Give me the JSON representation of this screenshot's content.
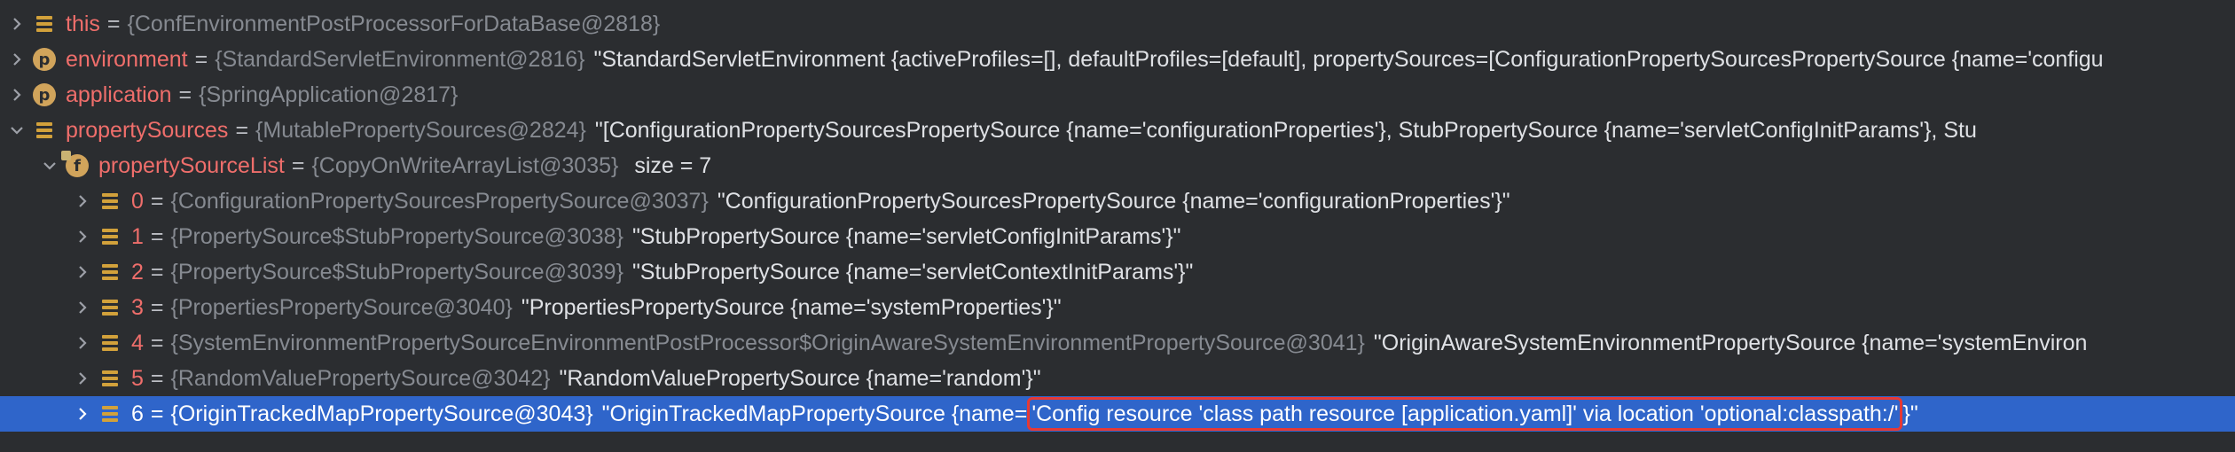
{
  "colors": {
    "background": "#2b2d30",
    "selected_row": "#2f65ca",
    "variable_name": "#ef6e6b",
    "reference": "#868a91",
    "value": "#dfe1e5",
    "icon": "#d2a13b",
    "highlight_border": "#e53935"
  },
  "rows": [
    {
      "icon": "field-lines-icon",
      "expanded": false,
      "name": "this",
      "ref": "{ConfEnvironmentPostProcessorForDataBase@2818}",
      "value": ""
    },
    {
      "icon": "property-p-icon",
      "badge": "p",
      "expanded": false,
      "name": "environment",
      "ref": "{StandardServletEnvironment@2816}",
      "value": "\"StandardServletEnvironment {activeProfiles=[], defaultProfiles=[default], propertySources=[ConfigurationPropertySourcesPropertySource {name='configu"
    },
    {
      "icon": "property-p-icon",
      "badge": "p",
      "expanded": false,
      "name": "application",
      "ref": "{SpringApplication@2817}",
      "value": ""
    },
    {
      "icon": "field-lines-icon",
      "expanded": true,
      "name": "propertySources",
      "ref": "{MutablePropertySources@2824}",
      "value": "\"[ConfigurationPropertySourcesPropertySource {name='configurationProperties'}, StubPropertySource {name='servletConfigInitParams'}, Stu"
    },
    {
      "icon": "final-field-f-icon",
      "badge": "f",
      "expanded": true,
      "name": "propertySourceList",
      "ref": "{CopyOnWriteArrayList@3035}",
      "value": "",
      "size": "size = 7"
    },
    {
      "icon": "field-lines-icon",
      "expanded": false,
      "name": "0",
      "ref": "{ConfigurationPropertySourcesPropertySource@3037}",
      "value": "\"ConfigurationPropertySourcesPropertySource {name='configurationProperties'}\""
    },
    {
      "icon": "field-lines-icon",
      "expanded": false,
      "name": "1",
      "ref": "{PropertySource$StubPropertySource@3038}",
      "value": "\"StubPropertySource {name='servletConfigInitParams'}\""
    },
    {
      "icon": "field-lines-icon",
      "expanded": false,
      "name": "2",
      "ref": "{PropertySource$StubPropertySource@3039}",
      "value": "\"StubPropertySource {name='servletContextInitParams'}\""
    },
    {
      "icon": "field-lines-icon",
      "expanded": false,
      "name": "3",
      "ref": "{PropertiesPropertySource@3040}",
      "value": "\"PropertiesPropertySource {name='systemProperties'}\""
    },
    {
      "icon": "field-lines-icon",
      "expanded": false,
      "name": "4",
      "ref": "{SystemEnvironmentPropertySourceEnvironmentPostProcessor$OriginAwareSystemEnvironmentPropertySource@3041}",
      "value": "\"OriginAwareSystemEnvironmentPropertySource {name='systemEnviron"
    },
    {
      "icon": "field-lines-icon",
      "expanded": false,
      "name": "5",
      "ref": "{RandomValuePropertySource@3042}",
      "value": "\"RandomValuePropertySource {name='random'}\""
    },
    {
      "icon": "field-lines-icon",
      "expanded": false,
      "selected": true,
      "name": "6",
      "ref": "{OriginTrackedMapPropertySource@3043}",
      "value_prefix": "\"OriginTrackedMapPropertySource {name=",
      "value_highlight": "'Config resource 'class path resource [application.yaml]' via location 'optional:classpath:/'",
      "value_suffix": "}\""
    }
  ]
}
